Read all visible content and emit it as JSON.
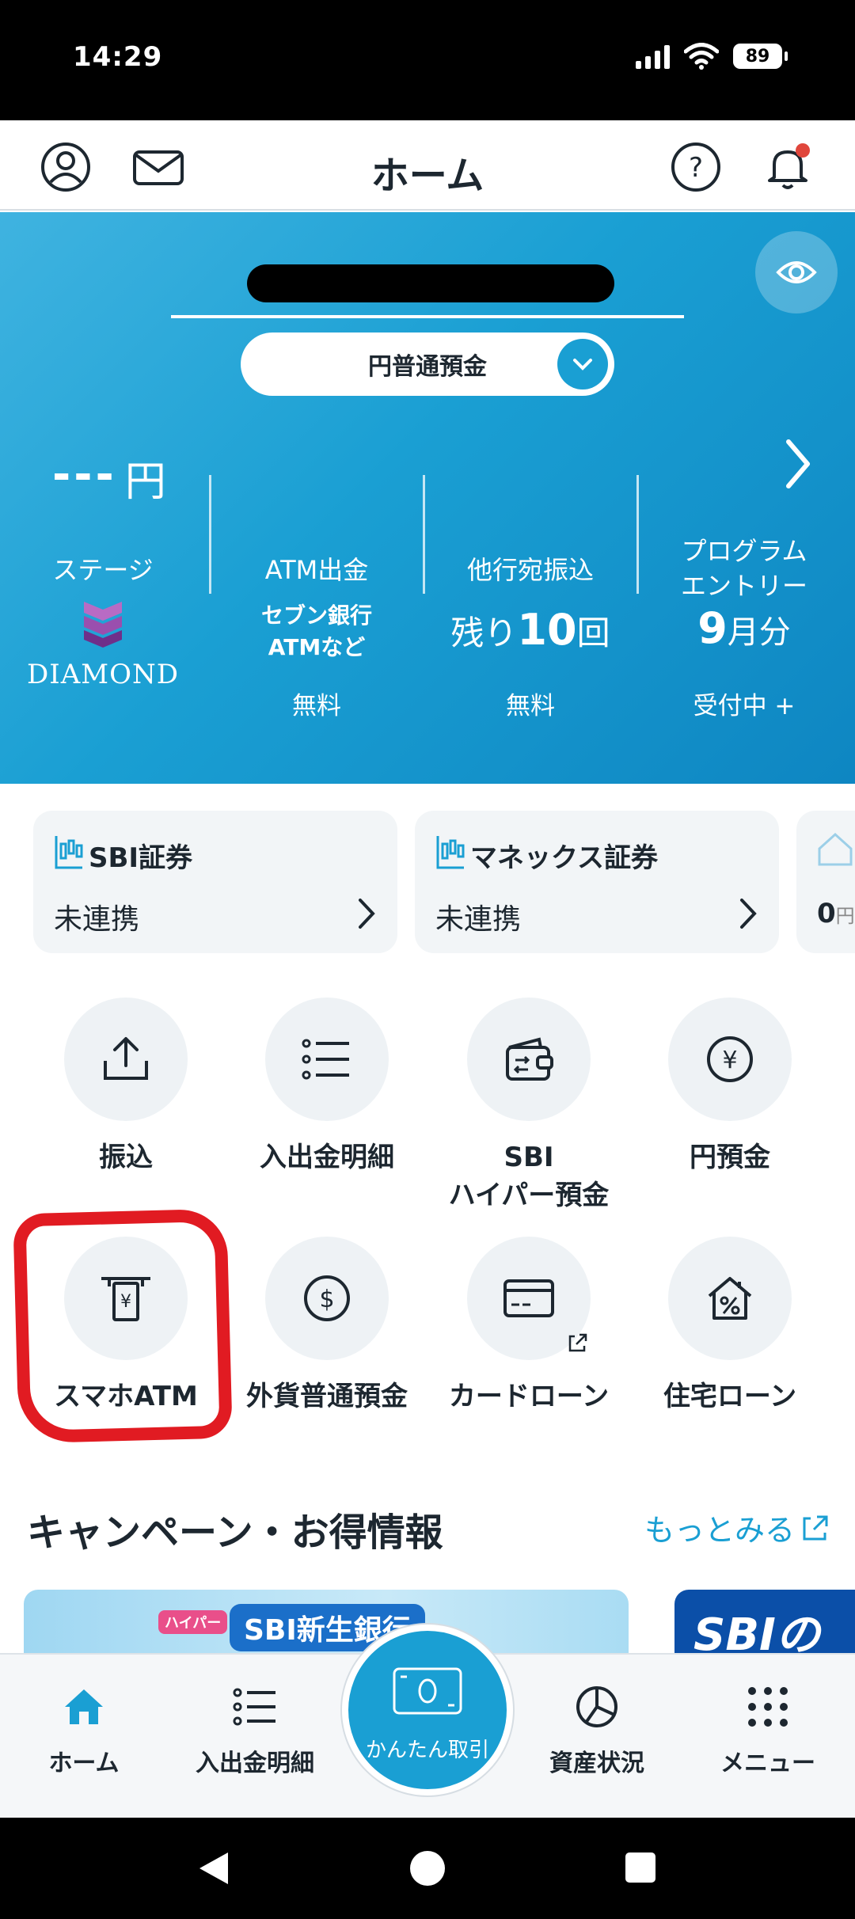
{
  "status_bar": {
    "time": "14:29",
    "battery": "89"
  },
  "header": {
    "title": "ホーム"
  },
  "hero": {
    "account_select": "円普通預金",
    "balance_value": "---",
    "balance_unit": "円",
    "stage": {
      "label": "ステージ",
      "rank": "DIAMOND"
    },
    "atm": {
      "label": "ATM出金",
      "detail_line1": "セブン銀行",
      "detail_line2": "ATMなど",
      "foot": "無料"
    },
    "transfer": {
      "label": "他行宛振込",
      "prefix": "残り",
      "count": "10",
      "suffix": "回",
      "foot": "無料"
    },
    "program": {
      "label_line1": "プログラム",
      "label_line2": "エントリー",
      "month": "9",
      "month_suffix": "月分",
      "foot": "受付中 +"
    }
  },
  "linkages": [
    {
      "name": "SBI証券",
      "state": "未連携"
    },
    {
      "name": "マネックス証券",
      "state": "未連携"
    },
    {
      "partial_value": "0",
      "partial_unit": "円"
    }
  ],
  "menu": [
    {
      "label": "振込",
      "icon": "upload-tray-icon"
    },
    {
      "label": "入出金明細",
      "icon": "list-icon"
    },
    {
      "label": "SBI\nハイパー預金",
      "icon": "wallet-transfer-icon"
    },
    {
      "label": "円預金",
      "icon": "yen-coin-icon"
    },
    {
      "label": "スマホATM",
      "icon": "atm-yen-icon"
    },
    {
      "label": "外貨普通預金",
      "icon": "dollar-coin-icon"
    },
    {
      "label": "カードローン",
      "icon": "card-icon"
    },
    {
      "label": "住宅ローン",
      "icon": "house-percent-icon"
    }
  ],
  "campaign": {
    "title": "キャンペーン・お得情報",
    "more": "もっとみる",
    "banner1_tag": "ハイパー",
    "banner1_text": "SBI新生銀行",
    "banner2_text": "SBIの"
  },
  "bottom_nav": {
    "home": "ホーム",
    "history": "入出金明細",
    "quick": "かんたん取引",
    "assets": "資産状況",
    "menu": "メニュー"
  },
  "colors": {
    "accent": "#1a9fd3",
    "text": "#1d2730",
    "highlight_ring": "#e11b22",
    "notification_dot": "#e0463c"
  }
}
